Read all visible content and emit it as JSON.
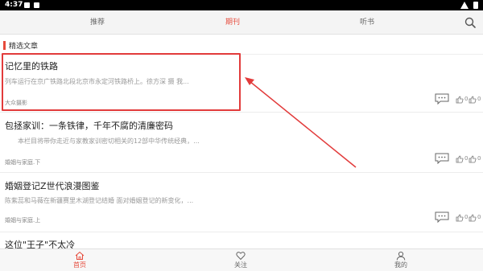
{
  "status_bar": {
    "time": "4:37"
  },
  "top_tabs": [
    {
      "label": "推荐",
      "active": false
    },
    {
      "label": "期刊",
      "active": true
    },
    {
      "label": "听书",
      "active": false
    }
  ],
  "section": {
    "title": "精选文章"
  },
  "articles": [
    {
      "title": "记忆里的铁路",
      "summary": "列车运行在京广铁路北段北京市永定河铁路桥上。徐方深 摄      我...",
      "source": "大众摄影",
      "likes": "0",
      "dislikes": "0"
    },
    {
      "title": "包拯家训：一条铁律，千年不腐的清廉密码",
      "summary": "本栏目将带你走近与家教家训密切相关的12部中华传统经典，...",
      "source": "婚姻与家庭.下",
      "likes": "0",
      "dislikes": "0"
    },
    {
      "title": "婚姻登记Z世代浪漫图鉴",
      "summary": "陈紫蕊和马薇在新疆赛里木湖登记结婚      面对婚姻登记的新变化，...",
      "source": "婚姻与家庭.上",
      "likes": "0",
      "dislikes": "0"
    },
    {
      "title": "这位\"王子\"不太冷",
      "summary": "",
      "source": "",
      "likes": "",
      "dislikes": ""
    }
  ],
  "bottom_nav": [
    {
      "label": "首页",
      "icon": "home-icon",
      "active": true
    },
    {
      "label": "关注",
      "icon": "heart-icon",
      "active": false
    },
    {
      "label": "我的",
      "icon": "profile-icon",
      "active": false
    }
  ],
  "colors": {
    "accent": "#e64a3b",
    "annotation": "#e23b3b"
  }
}
